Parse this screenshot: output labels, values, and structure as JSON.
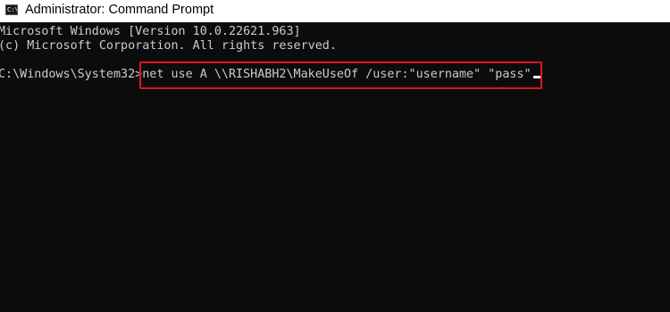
{
  "window": {
    "title": "Administrator: Command Prompt",
    "icon": "command-prompt-icon",
    "icon_glyph": "C:\\",
    "background_color": "#0c0c0c",
    "titlebar_color": "#ffffff",
    "text_color": "#cccccc",
    "highlight_color": "#e0141e"
  },
  "terminal": {
    "lines": [
      "Microsoft Windows [Version 10.0.22621.963]",
      "(c) Microsoft Corporation. All rights reserved."
    ],
    "prompt": "C:\\Windows\\System32>",
    "command": "net use A \\\\RISHABH2\\MakeUseOf /user:\"username\" \"pass\""
  }
}
